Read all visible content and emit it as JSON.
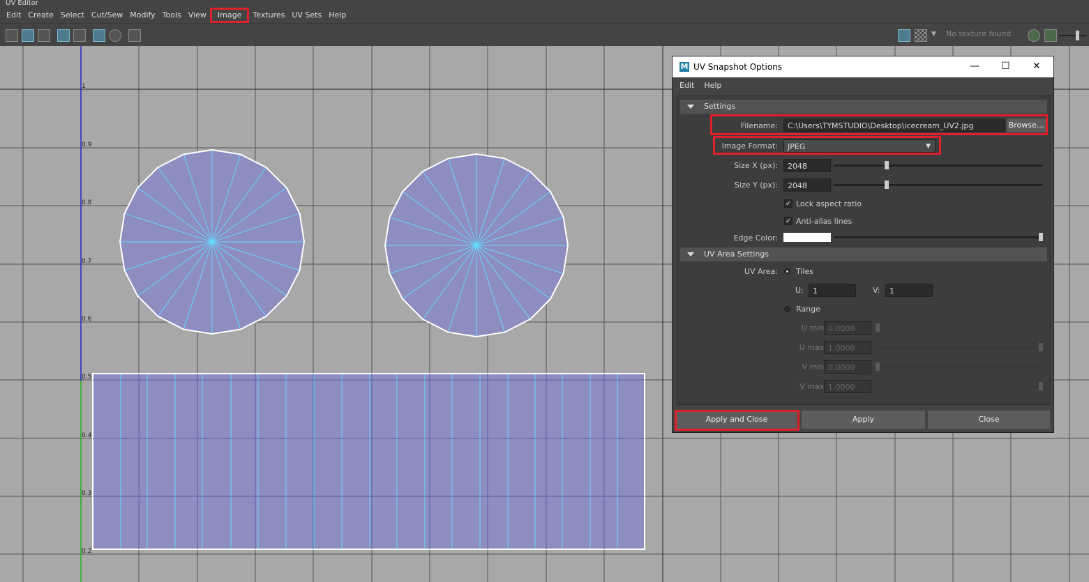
{
  "window": {
    "title": "UV Editor"
  },
  "menubar": [
    "Edit",
    "Create",
    "Select",
    "Cut/Sew",
    "Modify",
    "Tools",
    "View",
    "Image",
    "Textures",
    "UV Sets",
    "Help"
  ],
  "toolbar": {
    "texture_status": "No texture found"
  },
  "canvas": {
    "v_ticks": [
      "1",
      "0.9",
      "0.8",
      "0.7",
      "0.6",
      "0.5",
      "0.4",
      "0.3",
      "0.2"
    ]
  },
  "dialog": {
    "title": "UV Snapshot Options",
    "logo": "M",
    "menu": [
      "Edit",
      "Help"
    ],
    "settings": {
      "header": "Settings",
      "filename_label": "Filename:",
      "filename_value": "C:\\Users\\TYMSTUDIO\\Desktop\\icecream_UV2.jpg",
      "browse_label": "Browse...",
      "image_format_label": "Image Format:",
      "image_format_value": "JPEG",
      "size_x_label": "Size X (px):",
      "size_x_value": "2048",
      "size_y_label": "Size Y (px):",
      "size_y_value": "2048",
      "lock_aspect_label": "Lock aspect ratio",
      "lock_aspect_checked": true,
      "antialias_label": "Anti-alias lines",
      "antialias_checked": true,
      "edge_color_label": "Edge Color:",
      "edge_color": "#ffffff"
    },
    "uv_area": {
      "header": "UV Area Settings",
      "uv_area_label": "UV Area:",
      "tiles_label": "Tiles",
      "u_label": "U:",
      "u_value": "1",
      "v_label": "V:",
      "v_value": "1",
      "range_label": "Range",
      "umin_label": "U min:",
      "umin_value": "0.0000",
      "umax_label": "U max:",
      "umax_value": "1.0000",
      "vmin_label": "V min:",
      "vmin_value": "0.0000",
      "vmax_label": "V max:",
      "vmax_value": "1.0000"
    },
    "buttons": {
      "apply_close": "Apply and Close",
      "apply": "Apply",
      "close": "Close"
    }
  },
  "colors": {
    "highlight": "#e0202a",
    "uv_fill": "#8d8dc0",
    "uv_wire": "#66d9ff",
    "canvas_bg": "#a8a8a8"
  }
}
